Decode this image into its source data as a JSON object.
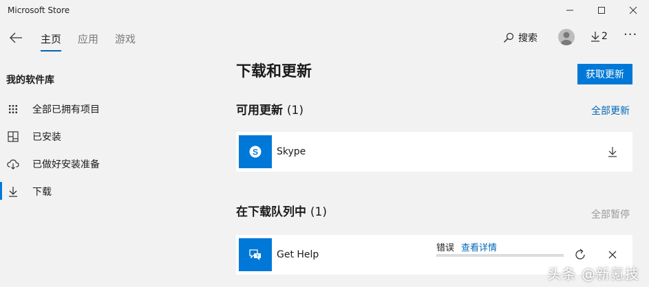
{
  "window": {
    "title": "Microsoft Store",
    "minimize_icon": "minimize-icon",
    "maximize_icon": "maximize-icon",
    "close_icon": "close-icon"
  },
  "nav": {
    "back_icon": "back-arrow-icon",
    "tabs": [
      {
        "label": "主页",
        "active": true
      },
      {
        "label": "应用",
        "active": false
      },
      {
        "label": "游戏",
        "active": false
      }
    ],
    "search_label": "搜索",
    "downloads_count": "2"
  },
  "sidebar": {
    "title": "我的软件库",
    "items": [
      {
        "label": "全部已拥有项目",
        "icon": "grid-icon"
      },
      {
        "label": "已安装",
        "icon": "installed-icon"
      },
      {
        "label": "已做好安装准备",
        "icon": "cloud-download-icon"
      },
      {
        "label": "下载",
        "icon": "download-icon",
        "selected": true
      }
    ]
  },
  "main": {
    "page_title": "下载和更新",
    "get_updates_button": "获取更新",
    "updates": {
      "title": "可用更新",
      "count": "(1)",
      "action": "全部更新",
      "items": [
        {
          "name": "Skype"
        }
      ]
    },
    "queue": {
      "title": "在下载队列中",
      "count": "(1)",
      "action": "全部暂停",
      "items": [
        {
          "name": "Get Help",
          "status": "错误",
          "status_link": "查看详情",
          "progress": 0
        }
      ]
    }
  },
  "watermark": "头条 @新氪技",
  "colors": {
    "accent": "#0078d7",
    "link": "#0067b8",
    "background": "#f2f2f2"
  }
}
